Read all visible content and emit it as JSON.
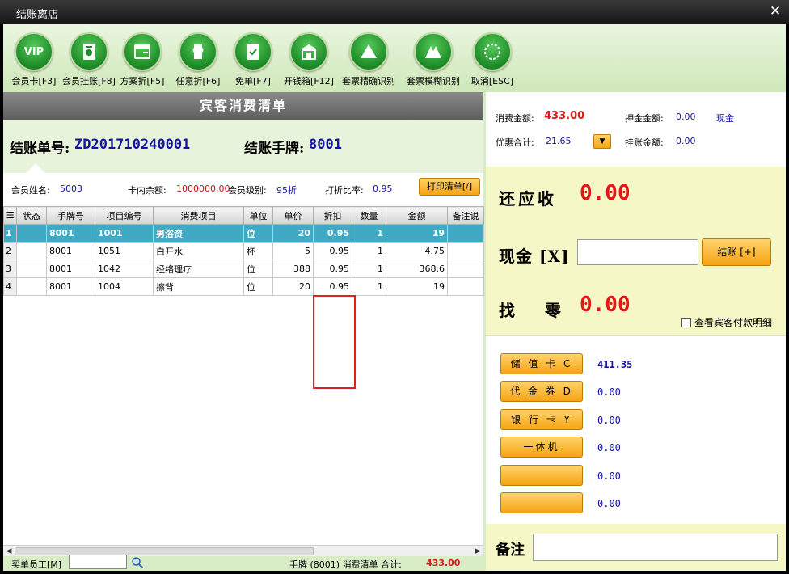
{
  "window": {
    "title": "结账离店",
    "close_glyph": "✕"
  },
  "colors": {
    "accent": "#f6a312",
    "selected_row": "#42a9c4",
    "amount_red": "#e01818",
    "value_blue": "#1414a0"
  },
  "toolbar": [
    {
      "label": "会员卡[F3]",
      "icon": "vip-icon",
      "glyph": "VIP"
    },
    {
      "label": "会员挂账[F8]",
      "icon": "member-bill-icon"
    },
    {
      "label": "方案折[F5]",
      "icon": "plan-discount-icon"
    },
    {
      "label": "任意折[F6]",
      "icon": "any-discount-icon"
    },
    {
      "label": "免单[F7]",
      "icon": "free-order-icon"
    },
    {
      "label": "开钱箱[F12]",
      "icon": "cash-drawer-icon"
    },
    {
      "label": "套票精确识别",
      "icon": "ticket-exact-icon"
    },
    {
      "label": "套票模糊识别",
      "icon": "ticket-fuzzy-icon"
    },
    {
      "label": "取消[ESC]",
      "icon": "cancel-icon"
    }
  ],
  "list": {
    "header": "宾客消费清单",
    "bill_no_label": "结账单号:",
    "bill_no": "ZD201710240001",
    "tag_label": "结账手牌:",
    "tag_no": "8001",
    "member_name_label": "会员姓名:",
    "member_name": "5003",
    "card_balance_label": "卡内余额:",
    "card_balance": "1000000.00",
    "member_level_label": "会员级别:",
    "member_level": "95折",
    "discount_ratio_label": "打折比率:",
    "discount_ratio": "0.95",
    "print_button": "打印清单[/]"
  },
  "table": {
    "row_header_glyph": "☰",
    "columns": [
      "状态",
      "手牌号",
      "项目编号",
      "消费项目",
      "单位",
      "单价",
      "折扣",
      "数量",
      "金额",
      "备注说"
    ],
    "rows": [
      {
        "idx": "1",
        "status": "",
        "tag": "8001",
        "code": "1001",
        "item": "男浴资",
        "unit": "位",
        "price": "20",
        "discount": "0.95",
        "qty": "1",
        "amount": "19",
        "note": ""
      },
      {
        "idx": "2",
        "status": "",
        "tag": "8001",
        "code": "1051",
        "item": "白开水",
        "unit": "杯",
        "price": "5",
        "discount": "0.95",
        "qty": "1",
        "amount": "4.75",
        "note": ""
      },
      {
        "idx": "3",
        "status": "",
        "tag": "8001",
        "code": "1042",
        "item": "经络理疗",
        "unit": "位",
        "price": "388",
        "discount": "0.95",
        "qty": "1",
        "amount": "368.6",
        "note": ""
      },
      {
        "idx": "4",
        "status": "",
        "tag": "8001",
        "code": "1004",
        "item": "擦背",
        "unit": "位",
        "price": "20",
        "discount": "0.95",
        "qty": "1",
        "amount": "19",
        "note": ""
      }
    ]
  },
  "footer": {
    "staff_label": "买单员工[M]",
    "staff_value": "",
    "summary_text": "手牌 (8001)  消费清单 合计:",
    "total": "433.00"
  },
  "summary": {
    "consume_label": "消费金额:",
    "consume_value": "433.00",
    "deposit_label": "押金金额:",
    "deposit_value": "0.00",
    "cash_text": "现金",
    "discount_label": "优惠合计:",
    "discount_value": "21.65",
    "credit_label": "挂账金额:",
    "credit_value": "0.00"
  },
  "payment": {
    "due_label": "还应收",
    "due_value": "0.00",
    "cash_label": "现金 [X]",
    "cash_input_value": "",
    "checkout_button": "结账 [+]",
    "change_label": "找   零",
    "change_value": "0.00",
    "view_detail_label": "查看宾客付款明细"
  },
  "methods": [
    {
      "label": "储 值 卡 C",
      "value": "411.35"
    },
    {
      "label": "代 金 券 D",
      "value": "0.00"
    },
    {
      "label": "银 行 卡 Y",
      "value": "0.00"
    },
    {
      "label": "一体机",
      "value": "0.00"
    },
    {
      "label": "",
      "value": "0.00"
    },
    {
      "label": "",
      "value": "0.00"
    }
  ],
  "remark": {
    "label": "备注",
    "value": ""
  }
}
